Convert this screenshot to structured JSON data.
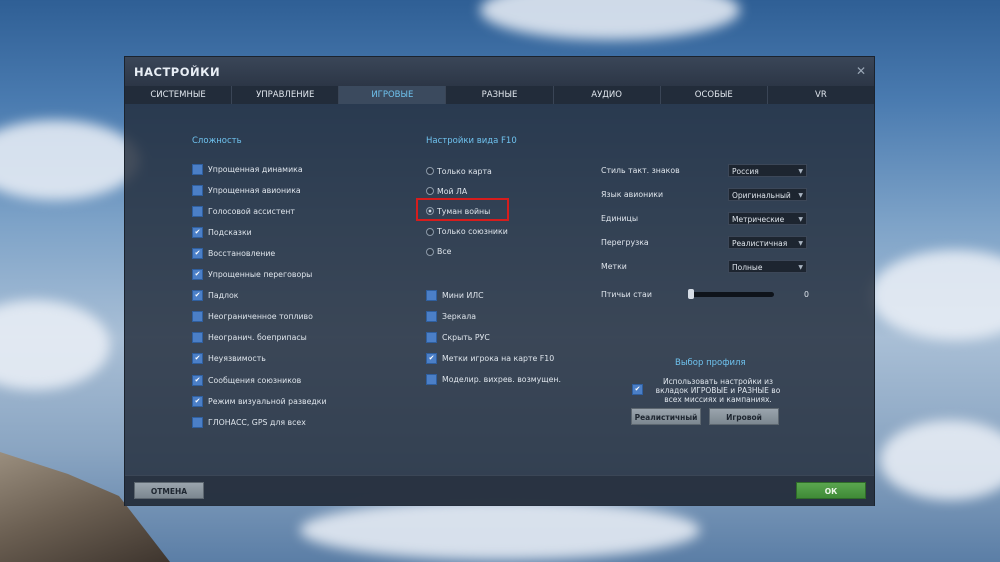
{
  "dialog": {
    "title": "НАСТРОЙКИ"
  },
  "tabs": [
    "СИСТЕМНЫЕ",
    "УПРАВЛЕНИЕ",
    "ИГРОВЫЕ",
    "РАЗНЫЕ",
    "АУДИО",
    "ОСОБЫЕ",
    "VR"
  ],
  "active_tab": "ИГРОВЫЕ",
  "difficulty": {
    "title": "Сложность",
    "items": [
      {
        "label": "Упрощенная динамика",
        "checked": false
      },
      {
        "label": "Упрощенная авионика",
        "checked": false
      },
      {
        "label": "Голосовой ассистент",
        "checked": false
      },
      {
        "label": "Подсказки",
        "checked": true
      },
      {
        "label": "Восстановление",
        "checked": true
      },
      {
        "label": "Упрощенные переговоры",
        "checked": true
      },
      {
        "label": "Падлок",
        "checked": true
      },
      {
        "label": "Неограниченное топливо",
        "checked": false
      },
      {
        "label": "Неогранич. боеприпасы",
        "checked": false
      },
      {
        "label": "Неуязвимость",
        "checked": true
      },
      {
        "label": "Сообщения союзников",
        "checked": true
      },
      {
        "label": "Режим визуальной разведки",
        "checked": true
      },
      {
        "label": "ГЛОНАСС, GPS для всех",
        "checked": false
      }
    ]
  },
  "f10": {
    "title": "Настройки вида F10",
    "radios": [
      {
        "label": "Только карта",
        "selected": false
      },
      {
        "label": "Мой ЛА",
        "selected": false
      },
      {
        "label": "Туман войны",
        "selected": true
      },
      {
        "label": "Только союзники",
        "selected": false
      },
      {
        "label": "Все",
        "selected": false
      }
    ],
    "checks": [
      {
        "label": "Мини ИЛС",
        "checked": false
      },
      {
        "label": "Зеркала",
        "checked": false
      },
      {
        "label": "Скрыть РУС",
        "checked": false
      },
      {
        "label": "Метки игрока на карте F10",
        "checked": true
      },
      {
        "label": "Моделир. вихрев. возмущен.",
        "checked": false
      }
    ]
  },
  "props": [
    {
      "label": "Стиль такт. знаков",
      "value": "Россия"
    },
    {
      "label": "Язык авионики",
      "value": "Оригинальный"
    },
    {
      "label": "Единицы",
      "value": "Метрические"
    },
    {
      "label": "Перегрузка",
      "value": "Реалистичная"
    },
    {
      "label": "Метки",
      "value": "Полные"
    }
  ],
  "birds": {
    "label": "Птичьи стаи",
    "value": "0",
    "level": 0
  },
  "profile": {
    "title": "Выбор профиля",
    "use_text": "Использовать настройки из вкладок ИГРОВЫЕ и РАЗНЫЕ во всех миссиях и кампаниях.",
    "use_checked": true,
    "btn_realistic": "Реалистичный",
    "btn_game": "Игровой"
  },
  "buttons": {
    "cancel": "ОТМЕНА",
    "ok": "ОК"
  },
  "colors": {
    "accent": "#6fc3ef",
    "checkbox": "#4b7fc7",
    "ok": "#4f9a45",
    "highlight": "#d61d1d"
  }
}
